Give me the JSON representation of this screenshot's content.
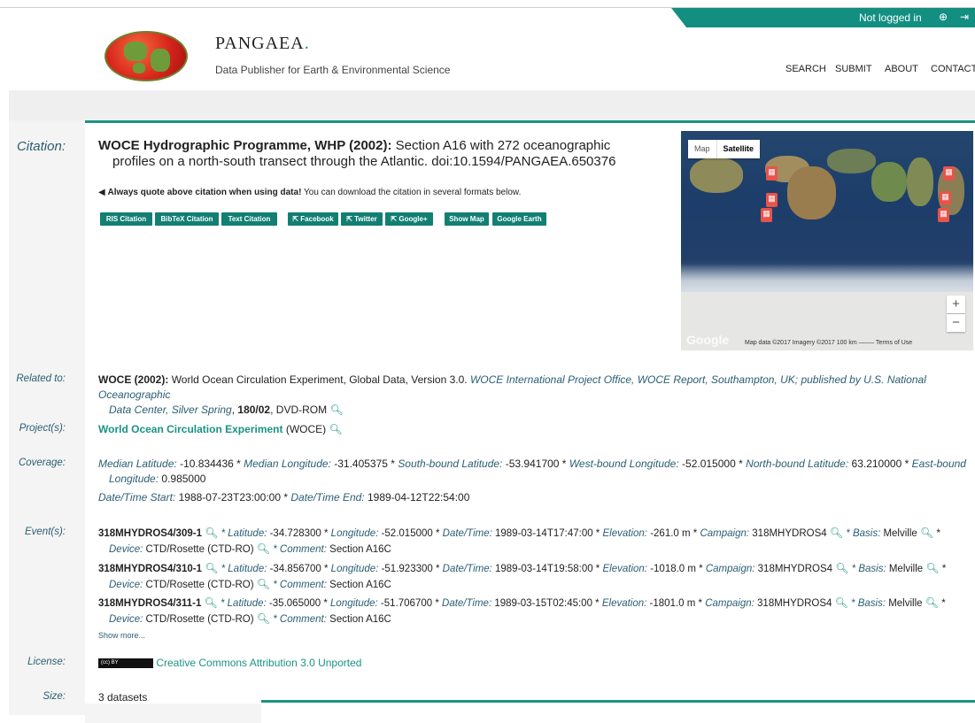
{
  "header": {
    "login_status": "Not logged in",
    "icons": [
      "plus-circle-icon",
      "sign-in-icon"
    ],
    "brand_name": "PANGAEA",
    "brand_dot": ".",
    "tagline": "Data Publisher for Earth & Environmental Science",
    "nav": [
      "SEARCH",
      "SUBMIT",
      "ABOUT",
      "CONTACT"
    ]
  },
  "labels": {
    "citation": "Citation:",
    "related": "Related to:",
    "projects": "Project(s):",
    "coverage": "Coverage:",
    "events": "Event(s):",
    "license": "License:",
    "size": "Size:"
  },
  "citation": {
    "authors": "WOCE Hydrographic Programme, WHP (2002):",
    "title_line1": " Section A16 with 272 oceanographic",
    "title_line2": "profiles on a north-south transect through the Atlantic. doi:10.1594/PANGAEA.650376",
    "quote_bold": "Always quote above citation when using data!",
    "quote_rest": " You can download the citation in several formats below.",
    "buttons": [
      "RIS Citation",
      "BibTeX Citation",
      "Text Citation",
      "Facebook",
      "Twitter",
      "Google+",
      "Show Map",
      "Google Earth"
    ]
  },
  "map": {
    "type_map": "Map",
    "type_satellite": "Satellite",
    "zoom_in": "+",
    "zoom_out": "−",
    "google": "Google",
    "attribution": "Map data ©2017 Imagery ©2017   100 km ⎯⎯⎯⎯⎯      Terms of Use"
  },
  "related": {
    "bold": "WOCE (2002):",
    "text": " World Ocean Circulation Experiment, Global Data, Version 3.0. ",
    "ital": "WOCE International Project Office, WOCE Report, Southampton, UK; published by U.S. National Oceanographic",
    "line2_ital": "Data Center, Silver Spring",
    "line2_text": ", ",
    "line2_bold": "180/02",
    "line2_rest": ", DVD-ROM"
  },
  "project": {
    "name": "World Ocean Circulation Experiment",
    "abbr": " (WOCE)"
  },
  "coverage": {
    "median_lat_label": "Median Latitude:",
    "median_lat": " -10.834436 * ",
    "median_lon_label": "Median Longitude:",
    "median_lon": " -31.405375 * ",
    "south_label": "South-bound Latitude:",
    "south": " -53.941700 * ",
    "west_label": "West-bound Longitude:",
    "west": " -52.015000 * ",
    "north_label": "North-bound Latitude:",
    "north": " 63.210000 * ",
    "east_label": "East-bound",
    "east_label2": "Longitude:",
    "east": " 0.985000",
    "start_label": "Date/Time Start:",
    "start": " 1988-07-23T23:00:00 * ",
    "end_label": "Date/Time End:",
    "end": " 1989-04-12T22:54:00"
  },
  "events": [
    {
      "name": "318MHYDROS4/309-1",
      "lat": " -34.728300 * ",
      "lon": " -52.015000 * ",
      "dt": " 1989-03-14T17:47:00 * ",
      "elev": " -261.0 m * ",
      "campaign": " 318MHYDROS4",
      "basis": " Melville",
      "device": " CTD/Rosette (CTD-RO)",
      "comment": " Section A16C"
    },
    {
      "name": "318MHYDROS4/310-1",
      "lat": " -34.856700 * ",
      "lon": " -51.923300 * ",
      "dt": " 1989-03-14T19:58:00 * ",
      "elev": " -1018.0 m * ",
      "campaign": " 318MHYDROS4",
      "basis": " Melville",
      "device": " CTD/Rosette (CTD-RO)",
      "comment": " Section A16C"
    },
    {
      "name": "318MHYDROS4/311-1",
      "lat": " -35.065000 * ",
      "lon": " -51.706700 * ",
      "dt": " 1989-03-15T02:45:00 * ",
      "elev": " -1801.0 m * ",
      "campaign": " 318MHYDROS4",
      "basis": " Melville",
      "device": " CTD/Rosette (CTD-RO)",
      "comment": " Section A16C"
    }
  ],
  "event_labels": {
    "lat": " * Latitude:",
    "lon": "Longitude:",
    "dt": "Date/Time:",
    "elev": "Elevation:",
    "campaign": "Campaign:",
    "basis": " * Basis:",
    "device": "Device:",
    "comment": " * Comment:",
    "star": " *"
  },
  "show_more": "Show more...",
  "license": {
    "badge": "(cc) BY",
    "text": "Creative Commons Attribution 3.0 Unported"
  },
  "size": "3 datasets",
  "colors": {
    "teal": "#1a9384",
    "label_blue": "#2b5e73",
    "button": "#127f73"
  }
}
